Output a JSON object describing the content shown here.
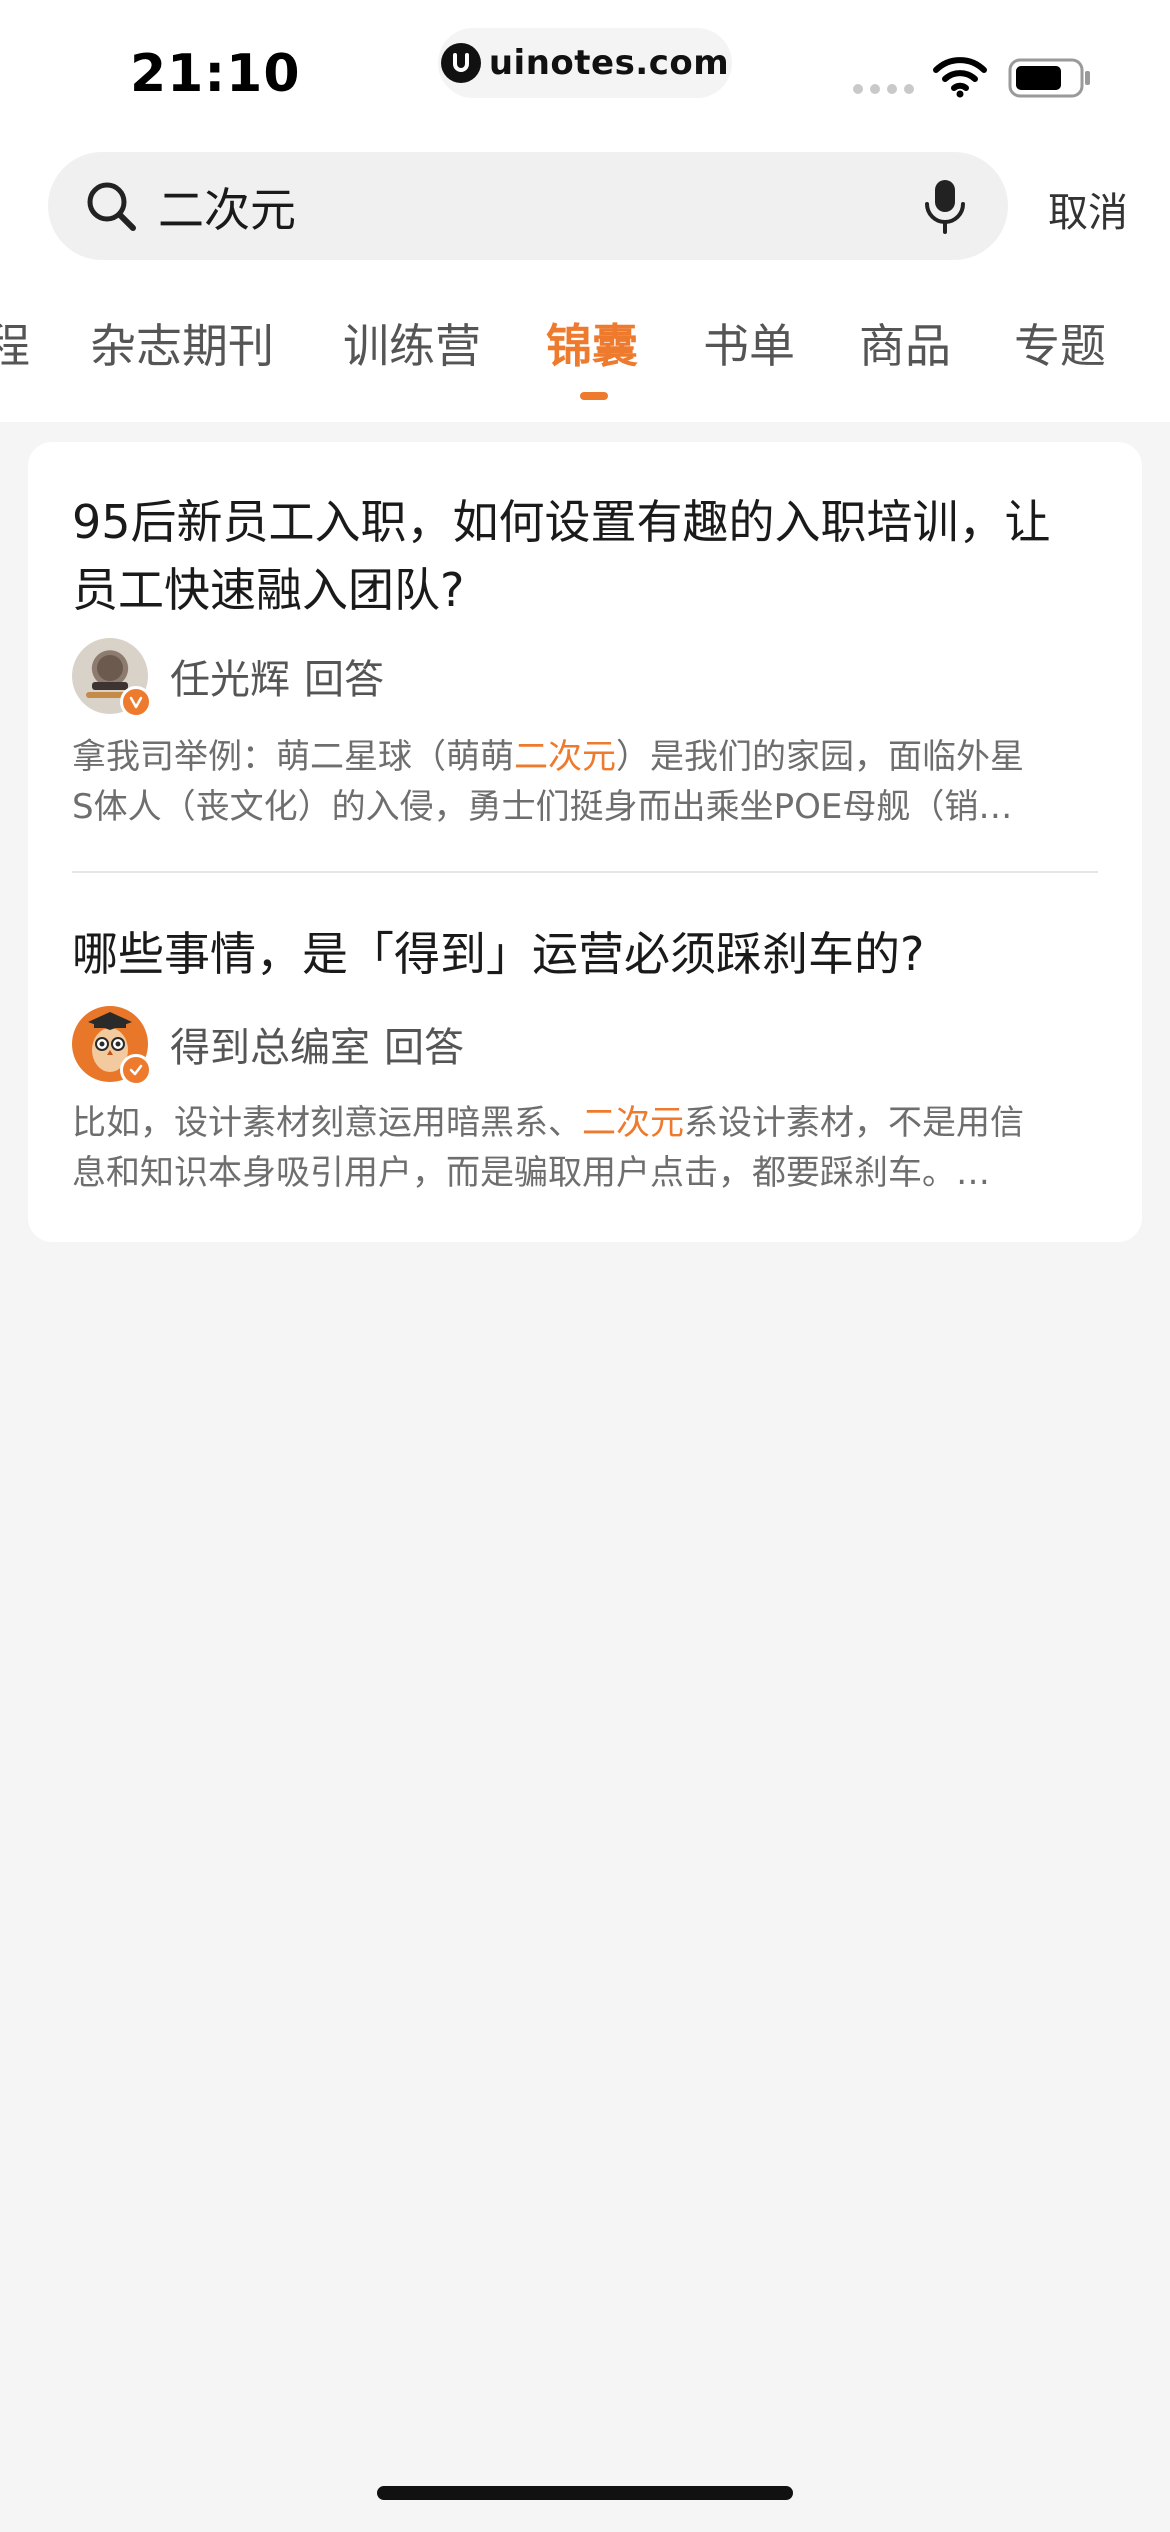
{
  "status_bar": {
    "time": "21:10",
    "url": "uinotes.com"
  },
  "search": {
    "query": "二次元",
    "cancel_label": "取消"
  },
  "tabs": [
    {
      "label": "程"
    },
    {
      "label": "杂志期刊"
    },
    {
      "label": "训练营"
    },
    {
      "label": "锦囊",
      "active": true
    },
    {
      "label": "书单"
    },
    {
      "label": "商品"
    },
    {
      "label": "专题"
    }
  ],
  "results": [
    {
      "title_line1": "95后新员工入职，如何设置有趣的入职培训，让",
      "title_line2": "员工快速融入团队?",
      "author": "任光辉",
      "action": "回答",
      "excerpt_line1_pre": "拿我司举例：萌二星球（萌萌",
      "excerpt_line1_hl": "二次元",
      "excerpt_line1_post": "）是我们的家园，面临外星",
      "excerpt_line2": "S体人（丧文化）的入侵，勇士们挺身而出乘坐POE母舰（销…"
    },
    {
      "title_line1": "哪些事情，是「得到」运营必须踩刹车的?",
      "author": "得到总编室",
      "action": "回答",
      "excerpt_line1_pre": "比如，设计素材刻意运用暗黑系、",
      "excerpt_line1_hl": "二次元",
      "excerpt_line1_post": "系设计素材，不是用信",
      "excerpt_line2": "息和知识本身吸引用户，而是骗取用户点击，都要踩刹车。…"
    }
  ],
  "colors": {
    "accent": "#ee7a2e",
    "background": "#f5f5f5",
    "card": "#ffffff"
  }
}
